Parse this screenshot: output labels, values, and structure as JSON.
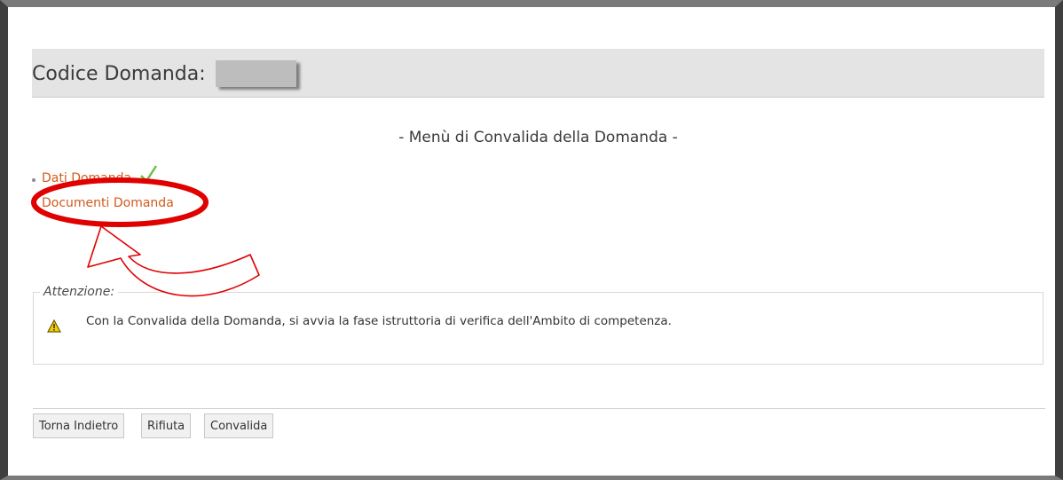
{
  "header": {
    "label": "Codice Domanda:"
  },
  "menu": {
    "title": "- Menù di Convalida della Domanda -",
    "items": [
      {
        "label": "Dati Domanda",
        "completed": true
      },
      {
        "label": "Documenti Domanda",
        "completed": false
      }
    ]
  },
  "notice": {
    "legend": "Attenzione:",
    "text": "Con la Convalida della Domanda, si avvia la fase istruttoria di verifica dell'Ambito di competenza.",
    "icon": "warning-icon"
  },
  "buttons": {
    "back": "Torna Indietro",
    "reject": "Rifiuta",
    "validate": "Convalida"
  },
  "colors": {
    "link": "#d25a1e",
    "header_bg": "#e4e4e4",
    "annotation": "#e00000",
    "check": "#6cc04a"
  }
}
